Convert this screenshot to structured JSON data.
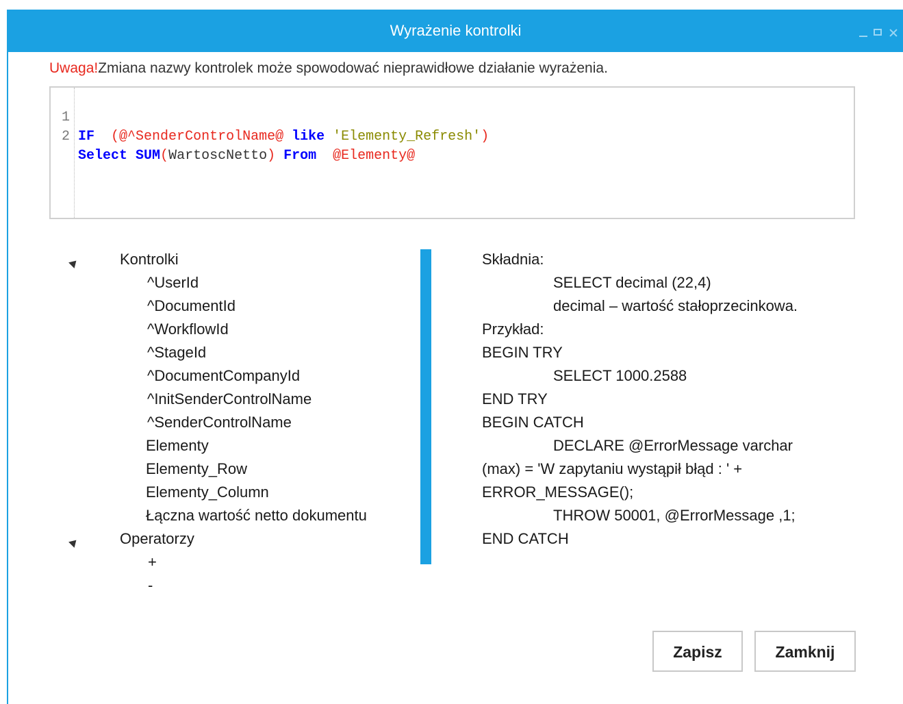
{
  "window": {
    "title": "Wyrażenie kontrolki"
  },
  "warning": {
    "label": "Uwaga!",
    "text": "Zmiana nazwy kontrolek może spowodować nieprawidłowe działanie wyrażenia."
  },
  "editor": {
    "line_numbers": [
      "1",
      "2"
    ],
    "line1": {
      "kw_if": "IF",
      "paren_open": "(",
      "var": "@^SenderControlName@",
      "kw_like": "like",
      "str": "'Elementy_Refresh'",
      "paren_close": ")"
    },
    "line2": {
      "kw_select": "Select",
      "kw_sum": "SUM",
      "paren_open": "(",
      "ident": "WartoscNetto",
      "paren_close": ")",
      "kw_from": "From",
      "var": "@Elementy@"
    }
  },
  "tree": {
    "groups": [
      {
        "label": "Kontrolki",
        "items": [
          "^UserId",
          "^DocumentId",
          "^WorkflowId",
          "^StageId",
          "^DocumentCompanyId",
          "^InitSenderControlName",
          "^SenderControlName",
          "Elementy",
          "Elementy_Row",
          "Elementy_Column",
          "Łączna wartość netto dokumentu"
        ]
      },
      {
        "label": "Operatorzy",
        "items": [
          "+",
          "-"
        ]
      }
    ]
  },
  "syntax_help": {
    "lines": [
      "Składnia:",
      "SELECT decimal (22,4)",
      "decimal – wartość stałoprzecinkowa.",
      "Przykład:",
      "BEGIN TRY",
      "SELECT 1000.2588",
      "END TRY",
      "BEGIN CATCH",
      "DECLARE @ErrorMessage varchar",
      "(max) = 'W zapytaniu wystąpił błąd : ' +",
      "ERROR_MESSAGE();",
      "THROW 50001,  @ErrorMessage ,1;",
      "END CATCH"
    ]
  },
  "buttons": {
    "save": "Zapisz",
    "close": "Zamknij"
  },
  "colors": {
    "accent": "#1ba1e2",
    "warning": "#e8281e",
    "keyword": "#0000ff",
    "string": "#8a8a00"
  }
}
